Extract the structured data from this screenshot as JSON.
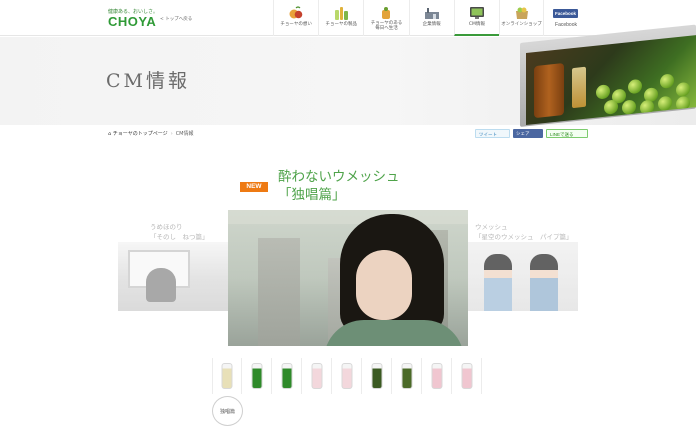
{
  "header": {
    "tagline": "健康ある、おいしさ。",
    "brand": "CHOYA",
    "back_link": "< トップへ戻る",
    "nav": [
      {
        "label": "チョーヤの想い",
        "icon": "fruit-icon"
      },
      {
        "label": "チョーヤの製品",
        "icon": "bottles-icon"
      },
      {
        "label": "チョーヤのある\n毎日へ生活",
        "icon": "lifestyle-icon"
      },
      {
        "label": "企業情報",
        "icon": "factory-icon"
      },
      {
        "label": "CM情報",
        "icon": "tv-icon",
        "active": true
      },
      {
        "label": "オンラインショップ",
        "icon": "shop-icon"
      }
    ],
    "facebook": {
      "badge": "Facebook",
      "label": "Facebook"
    }
  },
  "page_title": "CM情報",
  "breadcrumb": {
    "home": "チョーヤのトップページ",
    "current": "CM情報"
  },
  "share": {
    "tweet": "ツイート",
    "facebook": "シェア",
    "line": "LINEで送る"
  },
  "feature": {
    "badge": "NEW",
    "title_line1": "酔わないウメッシュ",
    "title_line2": "「独唱篇」",
    "left_caption_line1": "うめほのり",
    "left_caption_line2": "「そのし　ねつ篇」",
    "right_caption_line1": "ウメッシュ",
    "right_caption_line2": "「星空のウメッシュ　パイプ篇」"
  },
  "products": {
    "active_label": "独唱篇",
    "colors": [
      "#e8e0b8",
      "#2f8a2a",
      "#2f8a2a",
      "#f3d7dc",
      "#f3d7dc",
      "#3b5a22",
      "#4b6a28",
      "#f0c6d0",
      "#f0c6d0"
    ]
  }
}
